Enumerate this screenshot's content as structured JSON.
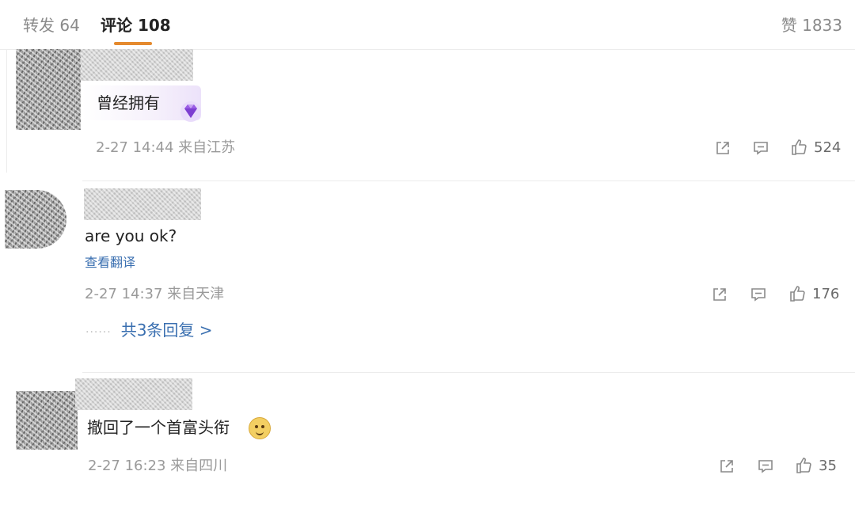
{
  "tabs": {
    "reposts": "转发 64",
    "comments": "评论 108",
    "likes": "赞 1833"
  },
  "comments": [
    {
      "text": "曾经拥有",
      "badge_icon": "gem-icon",
      "meta": "2-27 14:44 来自江苏",
      "likes": "524"
    },
    {
      "text": "are you ok?",
      "translate": "查看翻译",
      "meta": "2-27 14:37 来自天津",
      "likes": "176",
      "replies": "共3条回复 >"
    },
    {
      "text": "撤回了一个首富头衔",
      "emoji": "doge-emoji",
      "meta": "2-27 16:23 来自四川",
      "likes": "35"
    }
  ],
  "colors": {
    "accent_underline": "#e58a2e",
    "link_blue": "#3a6fb0",
    "meta_gray": "#9a9a9a"
  }
}
